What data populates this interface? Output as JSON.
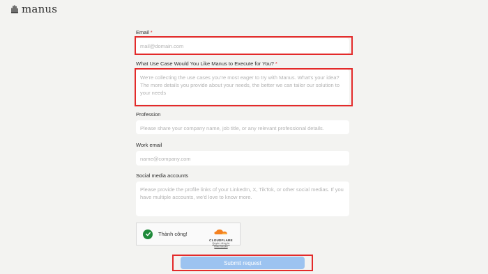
{
  "brand": {
    "name": "manus",
    "icon": "manus-hand-icon"
  },
  "form": {
    "email": {
      "label": "Email",
      "required_mark": "*",
      "placeholder": "mail@domain.com"
    },
    "use_case": {
      "label": "What Use Case Would You Like Manus to Execute for You?",
      "required_mark": "*",
      "placeholder": "We're collecting the use cases you're most eager to try with Manus. What's your idea? The more details you provide about your needs, the better we can tailor our solution to your needs"
    },
    "profession": {
      "label": "Profession",
      "placeholder": "Please share your company name, job title, or any relevant professional details."
    },
    "work_email": {
      "label": "Work email",
      "placeholder": "name@company.com"
    },
    "social": {
      "label": "Social media accounts",
      "placeholder": "Please provide the profile links of your LinkedIn, X, TikTok, or other social medias. If you have multiple accounts, we'd love to know more."
    }
  },
  "captcha": {
    "status": "Thành công!",
    "provider": "CLOUDFLARE",
    "privacy_link": "Quyền riêng tư",
    "terms_link": "Điều khoản"
  },
  "submit": {
    "label": "Submit request"
  },
  "colors": {
    "background": "#f3f3f1",
    "highlight": "#e32a2a",
    "submit_bg": "#9cc3f0",
    "success_green": "#1f8a3a",
    "cloudflare_orange": "#f48120"
  }
}
